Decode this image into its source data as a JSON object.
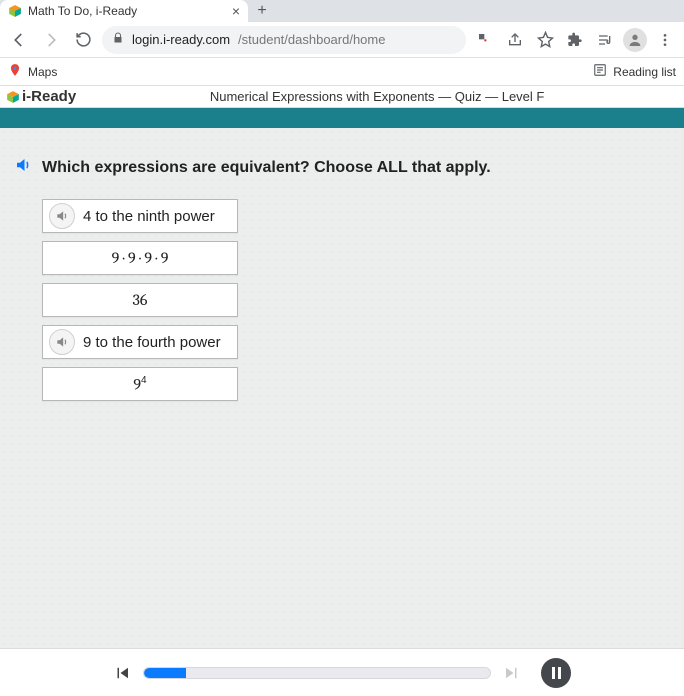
{
  "browser": {
    "tab_title": "Math To Do, i-Ready",
    "url_host": "login.i-ready.com",
    "url_path": "/student/dashboard/home",
    "bookmark_maps": "Maps",
    "reading_list": "Reading list"
  },
  "app": {
    "brand": "i-Ready",
    "lesson_title": "Numerical Expressions with Exponents — Quiz — Level F",
    "question": "Which expressions are equivalent? Choose ALL that apply.",
    "options": [
      {
        "label": "4 to the ninth power",
        "has_audio": true,
        "centered": false
      },
      {
        "label": "9 · 9 · 9 · 9",
        "has_audio": false,
        "centered": true
      },
      {
        "label": "36",
        "has_audio": false,
        "centered": true
      },
      {
        "label": "9 to the fourth power",
        "has_audio": true,
        "centered": false
      },
      {
        "label_html": "9⁴",
        "has_audio": false,
        "centered": true
      }
    ],
    "progress_percent": 12
  }
}
